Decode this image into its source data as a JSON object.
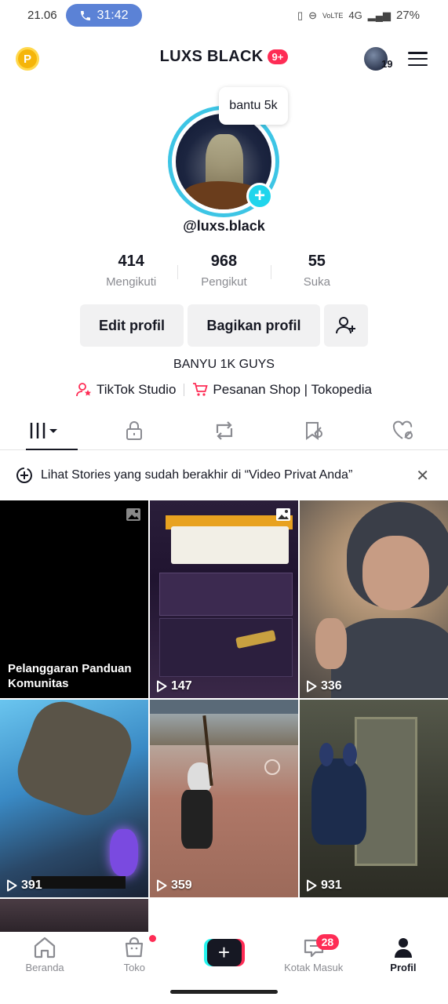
{
  "status_bar": {
    "time": "21.06",
    "call_timer": "31:42",
    "network": "4G",
    "battery": "27%"
  },
  "header": {
    "title": "LUXS BLACK",
    "notification_badge": "9+",
    "account_count": "19",
    "icons": [
      "coin-icon",
      "account-switch-avatar",
      "menu-icon"
    ]
  },
  "profile": {
    "note_bubble": "bantu 5k",
    "handle": "@luxs.black",
    "stats": [
      {
        "value": "414",
        "label": "Mengikuti"
      },
      {
        "value": "968",
        "label": "Pengikut"
      },
      {
        "value": "55",
        "label": "Suka"
      }
    ],
    "edit_label": "Edit profil",
    "share_label": "Bagikan profil",
    "bio": "BANYU 1K GUYS",
    "links": [
      {
        "label": "TikTok Studio",
        "icon": "creator-icon"
      },
      {
        "label": "Pesanan Shop | Tokopedia",
        "icon": "cart-icon"
      }
    ]
  },
  "tabs": [
    "videos-grid-icon",
    "private-lock-icon",
    "repost-icon",
    "favorites-icon",
    "liked-icon"
  ],
  "notice": {
    "text": "Lihat Stories yang sudah berakhir di “Video Privat Anda”"
  },
  "grid": {
    "violation_text": "Pelanggaran Panduan Komunitas",
    "views": [
      "147",
      "336",
      "391",
      "359",
      "931"
    ]
  },
  "bottom_nav": {
    "items": [
      "Beranda",
      "Toko",
      "",
      "Kotak Masuk",
      "Profil"
    ],
    "inbox_badge": "28"
  },
  "colors": {
    "accent": "#fe2c55",
    "cyan": "#20d5ec",
    "call_pill": "#5b82d6"
  }
}
